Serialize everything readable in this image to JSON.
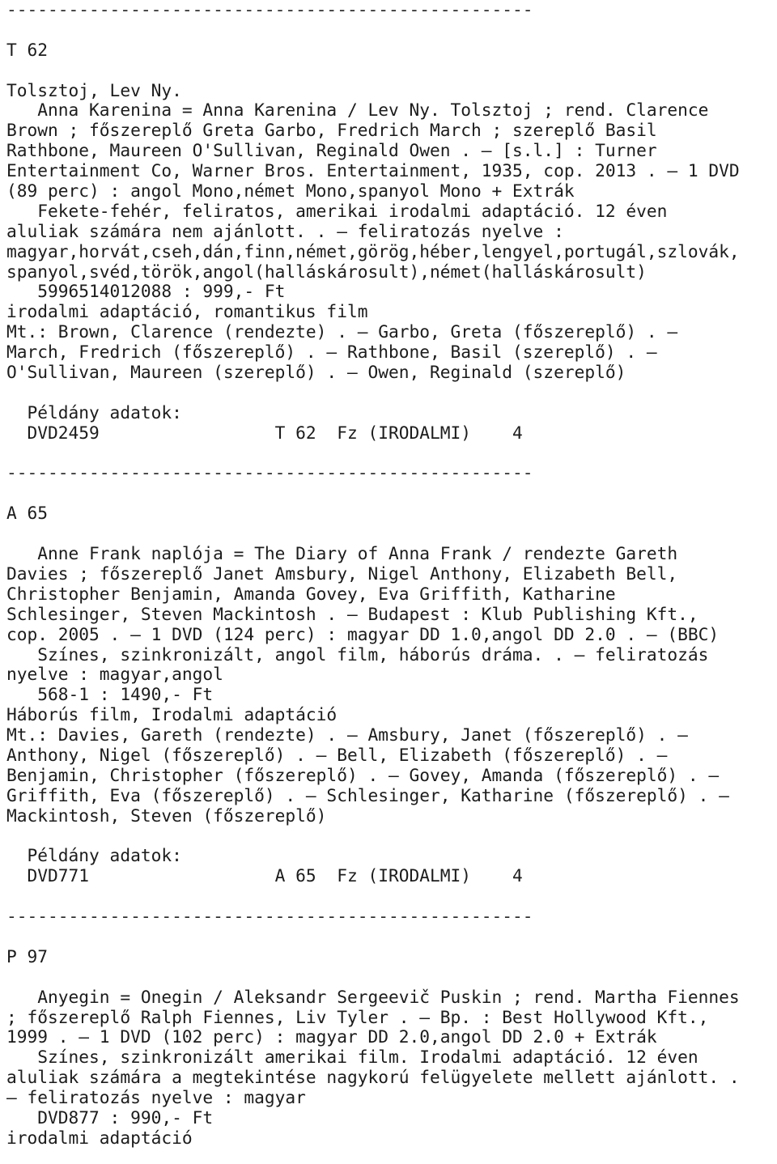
{
  "document": {
    "kind": "library-catalog-printout",
    "language": "hu",
    "separator": "---------------------------------------------------",
    "records": [
      {
        "call_number": "T 62",
        "author": "Tolsztoj, Lev Ny.",
        "title_statement": "Anna Karenina = Anna Karenina / Lev Ny. Tolsztoj ; rend. Clarence Brown ; főszereplő Greta Garbo, Fredrich March ; szereplő Basil Rathbone, Maureen O'Sullivan, Reginald Owen .",
        "imprint": "— [s.l.] : Turner Entertainment Co, Warner Bros. Entertainment, 1935, cop. 2013 .",
        "extent": "— 1 DVD (89 perc) : angol Mono,német Mono,spanyol Mono + Extrák",
        "notes": "Fekete-fehér, feliratos, amerikai irodalmi adaptáció. 12 éven aluliak számára nem ajánlott. . — feliratozás nyelve :",
        "subtitle_languages": "magyar,horvát,cseh,dán,finn,német,görög,héber,lengyel,portugál,szlovák,spanyol,svéd,török,angol(halláskárosult),német(halláskárosult)",
        "isbn_price": "5996514012088 : 999,- Ft",
        "subjects": "irodalmi adaptáció, romantikus film",
        "added_entries": "Mt.: Brown, Clarence (rendezte) . — Garbo, Greta (főszereplő) . — March, Fredrich (főszereplő) . — Rathbone, Basil (szereplő) . — O'Sullivan, Maureen (szereplő) . — Owen, Reginald (szereplő)",
        "copies_header": "Példány adatok:",
        "copy": {
          "barcode": "DVD2459",
          "shelfmark": "T 62",
          "location": "Fz (IRODALMI)",
          "count": "4"
        }
      },
      {
        "call_number": "A 65",
        "author": "",
        "title_statement": "Anne Frank naplója = The Diary of Anna Frank / rendezte Gareth Davies ; főszereplő Janet Amsbury, Nigel Anthony, Elizabeth Bell, Christopher Benjamin, Amanda Govey, Eva Griffith, Katharine Schlesinger, Steven Mackintosh .",
        "imprint": "— Budapest : Klub Publishing Kft., cop. 2005 .",
        "extent": "— 1 DVD (124 perc) : magyar DD 1.0,angol DD 2.0 . — (BBC)",
        "notes": "Színes, szinkronizált, angol film, háborús dráma. . — feliratozás nyelve : magyar,angol",
        "isbn_price": "568-1 : 1490,- Ft",
        "subjects": "Háborús film, Irodalmi adaptáció",
        "added_entries": "Mt.: Davies, Gareth (rendezte) . — Amsbury, Janet (főszereplő) . — Anthony, Nigel (főszereplő) . — Bell, Elizabeth (főszereplő) . — Benjamin, Christopher (főszereplő) . — Govey, Amanda (főszereplő) . — Griffith, Eva (főszereplő) . — Schlesinger, Katharine (főszereplő) . — Mackintosh, Steven (főszereplő)",
        "copies_header": "Példány adatok:",
        "copy": {
          "barcode": "DVD771",
          "shelfmark": "A 65",
          "location": "Fz (IRODALMI)",
          "count": "4"
        }
      },
      {
        "call_number": "P 97",
        "author": "",
        "title_statement": "Anyegin = Onegin / Aleksandr Sergeevič Puskin ; rend. Martha Fiennes ; főszereplő Ralph Fiennes, Liv Tyler .",
        "imprint": "— Bp. : Best Hollywood Kft., 1999 .",
        "extent": "— 1 DVD (102 perc) : magyar DD 2.0,angol DD 2.0 + Extrák",
        "notes": "Színes, szinkronizált amerikai film. Irodalmi adaptáció. 12 éven aluliak számára a megtekintése nagykorú felügyelete mellett ajánlott. . — feliratozás nyelve : magyar",
        "isbn_price": "DVD877 : 990,- Ft",
        "subjects": "irodalmi adaptáció"
      }
    ],
    "lines": [
      "---------------------------------------------------",
      "",
      "T 62",
      "",
      "Tolsztoj, Lev Ny.",
      "   Anna Karenina = Anna Karenina / Lev Ny. Tolsztoj ; rend. Clarence",
      "Brown ; főszereplő Greta Garbo, Fredrich March ; szereplő Basil",
      "Rathbone, Maureen O'Sullivan, Reginald Owen . — [s.l.] : Turner",
      "Entertainment Co, Warner Bros. Entertainment, 1935, cop. 2013 . — 1 DVD",
      "(89 perc) : angol Mono,német Mono,spanyol Mono + Extrák",
      "   Fekete-fehér, feliratos, amerikai irodalmi adaptáció. 12 éven",
      "aluliak számára nem ajánlott. . — feliratozás nyelve :",
      "magyar,horvát,cseh,dán,finn,német,görög,héber,lengyel,portugál,szlovák,",
      "spanyol,svéd,török,angol(halláskárosult),német(halláskárosult)",
      "   5996514012088 : 999,- Ft",
      "irodalmi adaptáció, romantikus film",
      "Mt.: Brown, Clarence (rendezte) . — Garbo, Greta (főszereplő) . —",
      "March, Fredrich (főszereplő) . — Rathbone, Basil (szereplő) . —",
      "O'Sullivan, Maureen (szereplő) . — Owen, Reginald (szereplő)",
      "",
      "  Példány adatok:",
      "  DVD2459                 T 62  Fz (IRODALMI)    4",
      "",
      "---------------------------------------------------",
      "",
      "A 65",
      "",
      "   Anne Frank naplója = The Diary of Anna Frank / rendezte Gareth",
      "Davies ; főszereplő Janet Amsbury, Nigel Anthony, Elizabeth Bell,",
      "Christopher Benjamin, Amanda Govey, Eva Griffith, Katharine",
      "Schlesinger, Steven Mackintosh . — Budapest : Klub Publishing Kft.,",
      "cop. 2005 . — 1 DVD (124 perc) : magyar DD 1.0,angol DD 2.0 . — (BBC)",
      "   Színes, szinkronizált, angol film, háborús dráma. . — feliratozás",
      "nyelve : magyar,angol",
      "   568-1 : 1490,- Ft",
      "Háborús film, Irodalmi adaptáció",
      "Mt.: Davies, Gareth (rendezte) . — Amsbury, Janet (főszereplő) . —",
      "Anthony, Nigel (főszereplő) . — Bell, Elizabeth (főszereplő) . —",
      "Benjamin, Christopher (főszereplő) . — Govey, Amanda (főszereplő) . —",
      "Griffith, Eva (főszereplő) . — Schlesinger, Katharine (főszereplő) . —",
      "Mackintosh, Steven (főszereplő)",
      "",
      "  Példány adatok:",
      "  DVD771                  A 65  Fz (IRODALMI)    4",
      "",
      "---------------------------------------------------",
      "",
      "P 97",
      "",
      "   Anyegin = Onegin / Aleksandr Sergeevič Puskin ; rend. Martha Fiennes",
      "; főszereplő Ralph Fiennes, Liv Tyler . — Bp. : Best Hollywood Kft.,",
      "1999 . — 1 DVD (102 perc) : magyar DD 2.0,angol DD 2.0 + Extrák",
      "   Színes, szinkronizált amerikai film. Irodalmi adaptáció. 12 éven",
      "aluliak számára a megtekintése nagykorú felügyelete mellett ajánlott. .",
      "— feliratozás nyelve : magyar",
      "   DVD877 : 990,- Ft",
      "irodalmi adaptáció"
    ]
  }
}
